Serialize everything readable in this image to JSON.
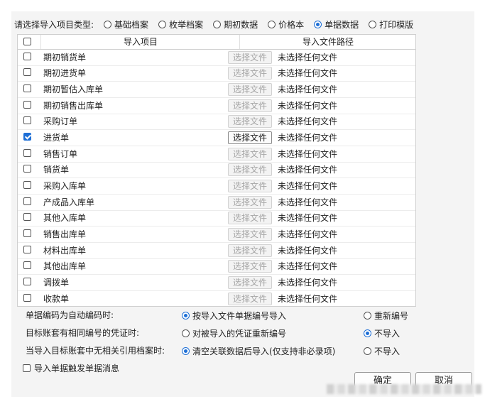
{
  "import_type": {
    "label": "请选择导入项目类型:",
    "options": [
      {
        "label": "基础档案",
        "selected": false
      },
      {
        "label": "枚举档案",
        "selected": false
      },
      {
        "label": "期初数据",
        "selected": false
      },
      {
        "label": "价格本",
        "selected": false
      },
      {
        "label": "单据数据",
        "selected": true
      },
      {
        "label": "打印模版",
        "selected": false
      }
    ]
  },
  "grid": {
    "columns": [
      "导入项目",
      "导入文件路径"
    ],
    "button_label": "选择文件",
    "rows": [
      {
        "name": "期初销货单",
        "checked": false,
        "path": "未选择任何文件"
      },
      {
        "name": "期初进货单",
        "checked": false,
        "path": "未选择任何文件"
      },
      {
        "name": "期初暂估入库单",
        "checked": false,
        "path": "未选择任何文件"
      },
      {
        "name": "期初销售出库单",
        "checked": false,
        "path": "未选择任何文件"
      },
      {
        "name": "采购订单",
        "checked": false,
        "path": "未选择任何文件"
      },
      {
        "name": "进货单",
        "checked": true,
        "path": "未选择任何文件"
      },
      {
        "name": "销售订单",
        "checked": false,
        "path": "未选择任何文件"
      },
      {
        "name": "销货单",
        "checked": false,
        "path": "未选择任何文件"
      },
      {
        "name": "采购入库单",
        "checked": false,
        "path": "未选择任何文件"
      },
      {
        "name": "产成品入库单",
        "checked": false,
        "path": "未选择任何文件"
      },
      {
        "name": "其他入库单",
        "checked": false,
        "path": "未选择任何文件"
      },
      {
        "name": "销售出库单",
        "checked": false,
        "path": "未选择任何文件"
      },
      {
        "name": "材料出库单",
        "checked": false,
        "path": "未选择任何文件"
      },
      {
        "name": "其他出库单",
        "checked": false,
        "path": "未选择任何文件"
      },
      {
        "name": "调拨单",
        "checked": false,
        "path": "未选择任何文件"
      },
      {
        "name": "收款单",
        "checked": false,
        "path": "未选择任何文件"
      }
    ]
  },
  "options": [
    {
      "label": "单据编码为自动编码时:",
      "choices": [
        {
          "label": "按导入文件单据编号导入",
          "selected": true
        },
        {
          "label": "重新编号",
          "selected": false
        }
      ]
    },
    {
      "label": "目标账套有相同编号的凭证时:",
      "choices": [
        {
          "label": "对被导入的凭证重新编号",
          "selected": false
        },
        {
          "label": "不导入",
          "selected": true
        }
      ]
    },
    {
      "label": "当导入目标账套中无相关引用档案时:",
      "choices": [
        {
          "label": "清空关联数据后导入(仅支持非必录项)",
          "selected": true
        },
        {
          "label": "不导入",
          "selected": false
        }
      ]
    }
  ],
  "notify": {
    "label": "导入单据触发单据消息",
    "checked": false
  },
  "footer": {
    "ok_label": "确定",
    "cancel_label": "取消"
  },
  "colors": {
    "accent": "#1e6fd6"
  }
}
